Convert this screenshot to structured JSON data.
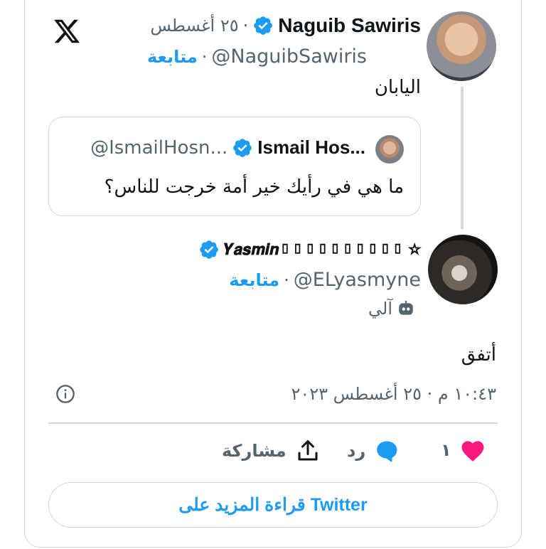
{
  "tweet": {
    "author_name": "Naguib Sawiris",
    "handle": "@NaguibSawiris",
    "date": "٢٥ أغسطس",
    "separator": "·",
    "follow_label": "متابعة",
    "text": "اليابان"
  },
  "quoted": {
    "author_name": "Ismail Hos...",
    "handle": "@IsmailHosn...",
    "text": "ما هي في رأيك خير أمة خرجت للناس؟"
  },
  "reply": {
    "author_name": "𝒀𝒂𝒔𝒎𝒊𝒏▯▯▯▯▯▯▯▯▯▯ ☆",
    "handle": "@ELyasmyne",
    "follow_label": "متابعة",
    "automated_label": "آلي",
    "text": "أتفق",
    "timestamp": "١٠:٤٣ م · ٢٥ أغسطس ٢٠٢٣"
  },
  "actions": {
    "like_count": "١",
    "reply_label": "رد",
    "share_label": "مشاركة"
  },
  "read_more_label": "قراءة المزيد على Twitter",
  "colors": {
    "accent": "#1d9bf0",
    "like": "#f91880",
    "border": "#cfd9de",
    "secondary_text": "#536471"
  },
  "icons": [
    "x-logo-icon",
    "verified-badge-icon",
    "info-icon",
    "heart-icon",
    "reply-icon",
    "share-icon",
    "robot-icon"
  ]
}
